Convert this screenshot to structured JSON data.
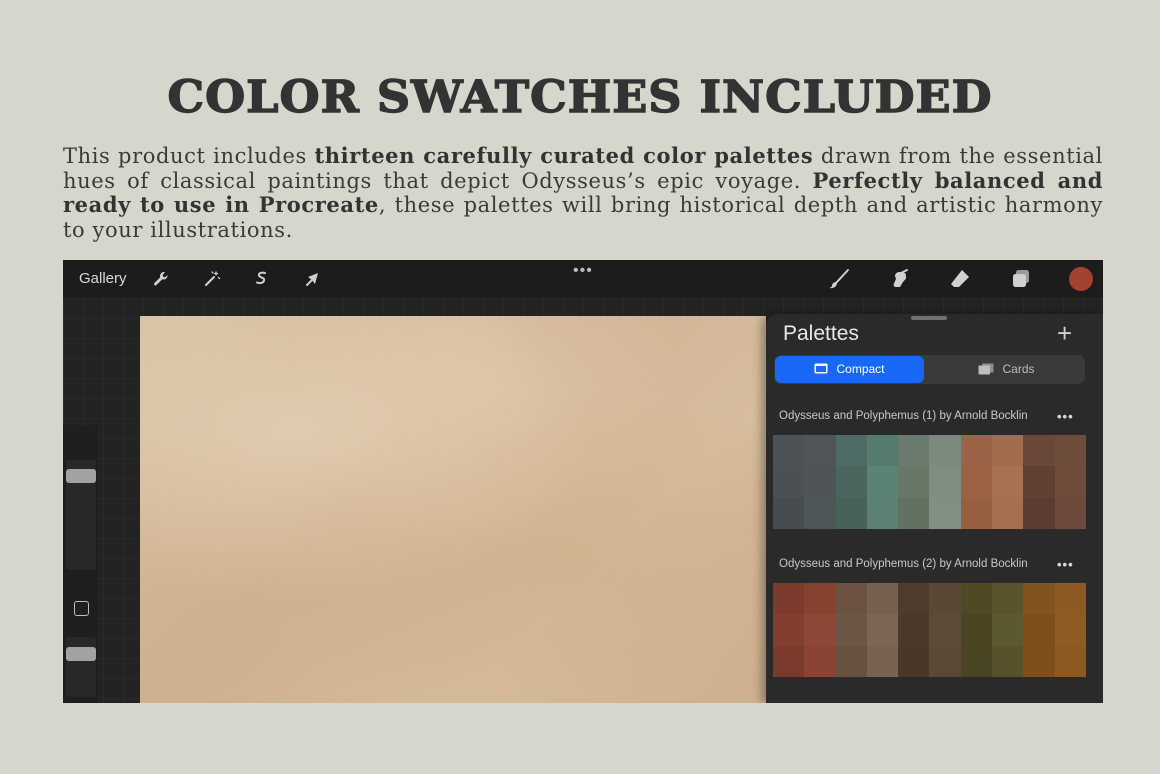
{
  "headline": "COLOR SWATCHES INCLUDED",
  "intro": {
    "p1": "This product includes ",
    "b1": "thirteen carefully curated color palettes",
    "p2": " drawn from the essential hues of classical paintings that depict Odysseus’s epic voyage. ",
    "b2": "Perfectly balanced and ready to use in Procreate",
    "p3": ", these palettes will bring historical depth and artistic harmony to your illustrations."
  },
  "app": {
    "gallery_label": "Gallery",
    "toolbar_dots": "•••",
    "current_color": "#a44230",
    "left_icons": [
      "wrench-icon",
      "magic-wand-icon",
      "selection-icon",
      "transform-arrow-icon"
    ],
    "right_icons": [
      "brush-icon",
      "smudge-icon",
      "eraser-icon",
      "layers-icon"
    ]
  },
  "panel": {
    "title": "Palettes",
    "add_label": "+",
    "tabs": {
      "compact": "Compact",
      "cards": "Cards"
    },
    "more_label": "•••",
    "palettes": [
      {
        "name": "Odysseus and Polyphemus (1) by Arnold Bocklin",
        "colors": [
          [
            "#4c5256",
            "#4f5559",
            "#4f6b65",
            "#557b70",
            "#6a7b6d",
            "#7b8a7d",
            "#9c6446",
            "#a26d4d",
            "#6a4839",
            "#6f4d3d"
          ],
          [
            "#4a5054",
            "#4e5458",
            "#4a665f",
            "#5a8275",
            "#687867",
            "#7e8d80",
            "#9b6244",
            "#a8714f",
            "#5f4033",
            "#6e4b3b"
          ],
          [
            "#464c50",
            "#4f5659",
            "#486259",
            "#5c8275",
            "#627160",
            "#808f82",
            "#97603f",
            "#a5704e",
            "#5b3c30",
            "#6d4a3b"
          ]
        ]
      },
      {
        "name": "Odysseus and Polyphemus (2) by Arnold Bocklin",
        "colors": [
          [
            "#7c3b2d",
            "#86412f",
            "#6b5243",
            "#76604f",
            "#4e3d2c",
            "#5a4836",
            "#4f4a24",
            "#59542b",
            "#80531f",
            "#8c5a22"
          ],
          [
            "#833e30",
            "#8e4636",
            "#6e5647",
            "#7b6654",
            "#4b3a29",
            "#5d4a38",
            "#4b4621",
            "#5c5830",
            "#7d5019",
            "#8d5d24"
          ],
          [
            "#7a3a2c",
            "#8b4433",
            "#695140",
            "#77634f",
            "#493827",
            "#5b4836",
            "#494421",
            "#57522b",
            "#7c4f1b",
            "#8a5a21"
          ]
        ]
      }
    ]
  }
}
